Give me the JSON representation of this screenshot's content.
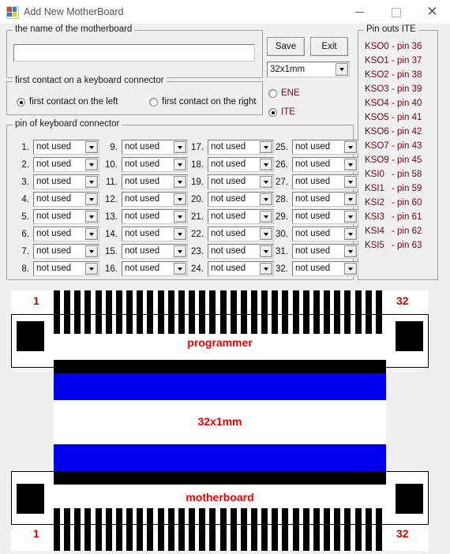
{
  "window": {
    "title": "Add New MotherBoard",
    "icon": "app-icon",
    "minimize": "minimize",
    "maximize": "maximize",
    "close": "close"
  },
  "name_group": {
    "caption": "the name of the motherboard",
    "value": "",
    "placeholder": ""
  },
  "contact_group": {
    "caption": "first contact on a keyboard connector",
    "options": [
      {
        "label": "first contact on the left",
        "selected": true
      },
      {
        "label": "first contact on the right",
        "selected": false
      }
    ]
  },
  "actions": {
    "save_label": "Save",
    "exit_label": "Exit",
    "connector_combo": {
      "value": "32x1mm",
      "options": [
        "32x1mm"
      ]
    },
    "chip_options": [
      {
        "label": "ENE",
        "selected": false
      },
      {
        "label": "ITE",
        "selected": true
      }
    ]
  },
  "pin_group": {
    "caption": "pin of keyboard connector",
    "default_value": "not used",
    "pins": [
      {
        "num": "1.",
        "value": "not used"
      },
      {
        "num": "2.",
        "value": "not used"
      },
      {
        "num": "3.",
        "value": "not used"
      },
      {
        "num": "4.",
        "value": "not used"
      },
      {
        "num": "5.",
        "value": "not used"
      },
      {
        "num": "6.",
        "value": "not used"
      },
      {
        "num": "7.",
        "value": "not used"
      },
      {
        "num": "8.",
        "value": "not used"
      },
      {
        "num": "9.",
        "value": "not used"
      },
      {
        "num": "10.",
        "value": "not used"
      },
      {
        "num": "11.",
        "value": "not used"
      },
      {
        "num": "12.",
        "value": "not used"
      },
      {
        "num": "13.",
        "value": "not used"
      },
      {
        "num": "14.",
        "value": "not used"
      },
      {
        "num": "15.",
        "value": "not used"
      },
      {
        "num": "16.",
        "value": "not used"
      },
      {
        "num": "17.",
        "value": "not used"
      },
      {
        "num": "18.",
        "value": "not used"
      },
      {
        "num": "19.",
        "value": "not used"
      },
      {
        "num": "20.",
        "value": "not used"
      },
      {
        "num": "21.",
        "value": "not used"
      },
      {
        "num": "22.",
        "value": "not used"
      },
      {
        "num": "23.",
        "value": "not used"
      },
      {
        "num": "24.",
        "value": "not used"
      },
      {
        "num": "25.",
        "value": "not used"
      },
      {
        "num": "26.",
        "value": "not used"
      },
      {
        "num": "27.",
        "value": "not used"
      },
      {
        "num": "28.",
        "value": "not used"
      },
      {
        "num": "29.",
        "value": "not used"
      },
      {
        "num": "30.",
        "value": "not used"
      },
      {
        "num": "31.",
        "value": "not used"
      },
      {
        "num": "32.",
        "value": "not used"
      }
    ]
  },
  "pinouts_group": {
    "caption": "Pin outs ITE",
    "rows": [
      {
        "signal": "KSO0",
        "pin": "- pin 36"
      },
      {
        "signal": "KSO1",
        "pin": "- pin 37"
      },
      {
        "signal": "KSO2",
        "pin": "- pin 38"
      },
      {
        "signal": "KSO3",
        "pin": "- pin 39"
      },
      {
        "signal": "KSO4",
        "pin": "- pin 40"
      },
      {
        "signal": "KSO5",
        "pin": "- pin 41"
      },
      {
        "signal": "KSO6",
        "pin": "- pin 42"
      },
      {
        "signal": "KSO7",
        "pin": "- pin 43"
      },
      {
        "signal": "KSO9",
        "pin": "- pin 45"
      },
      {
        "signal": "KSI0",
        "pin": "- pin 58"
      },
      {
        "signal": "KSI1",
        "pin": "- pin 59"
      },
      {
        "signal": "KSI2",
        "pin": "- pin 60"
      },
      {
        "signal": "KSI3",
        "pin": "- pin 61"
      },
      {
        "signal": "KSI4",
        "pin": "- pin 62"
      },
      {
        "signal": "KSI5",
        "pin": "- pin 63"
      }
    ]
  },
  "diagram": {
    "programmer_label": "programmer",
    "motherboard_label": "motherboard",
    "cable_label": "32x1mm",
    "top_first_pin": "1",
    "top_last_pin": "32",
    "bottom_first_pin": "1",
    "bottom_last_pin": "32",
    "teeth_count": 32,
    "colors": {
      "cable": "#0000ee",
      "contacts": "#000000",
      "label": "#ee0000",
      "pin_number": "#cc0000"
    }
  }
}
